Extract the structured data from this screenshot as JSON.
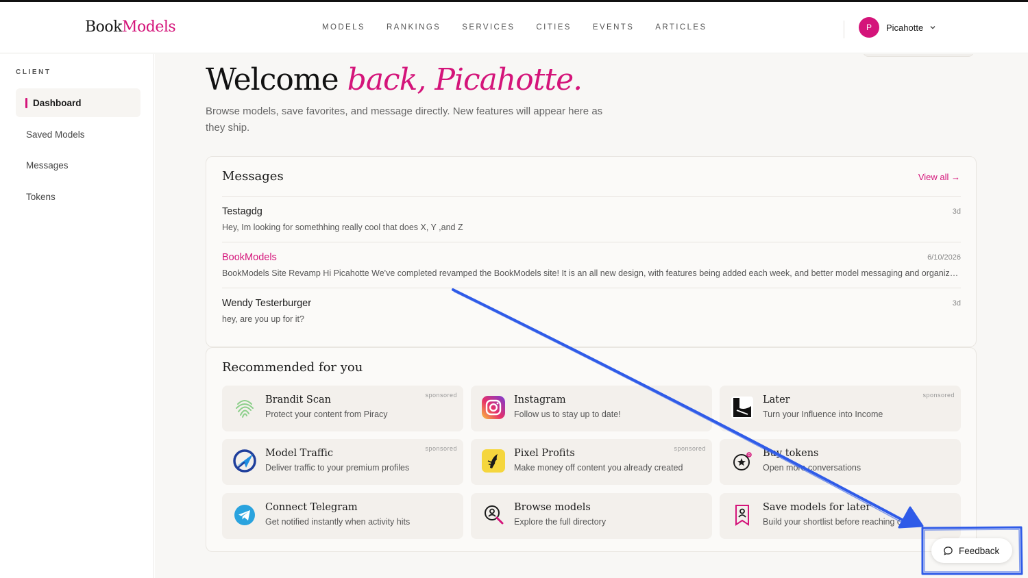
{
  "brand": {
    "part1": "Book",
    "part2": "Models"
  },
  "nav": [
    "MODELS",
    "RANKINGS",
    "SERVICES",
    "CITIES",
    "EVENTS",
    "ARTICLES"
  ],
  "user": {
    "initial": "P",
    "name": "Picahotte"
  },
  "sidebar": {
    "heading": "CLIENT",
    "items": [
      {
        "label": "Dashboard",
        "active": true
      },
      {
        "label": "Saved Models",
        "active": false
      },
      {
        "label": "Messages",
        "active": false
      },
      {
        "label": "Tokens",
        "active": false
      }
    ]
  },
  "welcome": {
    "lead": "Welcome",
    "accent": "back, Picahotte.",
    "intro": "Browse models, save favorites, and message directly. New features will appear here as they ship."
  },
  "messages": {
    "title": "Messages",
    "view_all": "View all →",
    "items": [
      {
        "from": "Testagdg",
        "time": "3d",
        "body": "Hey, Im looking for somethhing really cool that does X, Y ,and Z"
      },
      {
        "from": "BookModels",
        "time": "6/10/2026",
        "body": "BookModels Site Revamp Hi Picahotte We've completed revamped the BookModels site! It is an all new design, with features being added each week, and better model messaging and organization tools coming soon."
      },
      {
        "from": "Wendy Testerburger",
        "time": "3d",
        "body": "hey, are you up for it?"
      }
    ]
  },
  "recommended": {
    "title": "Recommended for you",
    "sponsored_label": "sponsored",
    "tiles": [
      {
        "name": "Brandit Scan",
        "desc": "Protect your content from Piracy",
        "sponsored": true,
        "icon": "fingerprint-icon"
      },
      {
        "name": "Instagram",
        "desc": "Follow us to stay up to date!",
        "sponsored": false,
        "icon": "instagram-icon"
      },
      {
        "name": "Later",
        "desc": "Turn your Influence into Income",
        "sponsored": true,
        "icon": "later-logo-icon"
      },
      {
        "name": "Model Traffic",
        "desc": "Deliver traffic to your premium profiles",
        "sponsored": true,
        "icon": "model-traffic-logo-icon"
      },
      {
        "name": "Pixel Profits",
        "desc": "Make money off content you already created",
        "sponsored": true,
        "icon": "pixel-profits-logo-icon"
      },
      {
        "name": "Buy tokens",
        "desc": "Open more conversations",
        "sponsored": false,
        "icon": "token-star-icon"
      },
      {
        "name": "Connect Telegram",
        "desc": "Get notified instantly when activity hits",
        "sponsored": false,
        "icon": "telegram-icon"
      },
      {
        "name": "Browse models",
        "desc": "Explore the full directory",
        "sponsored": false,
        "icon": "search-person-icon"
      },
      {
        "name": "Save models for later",
        "desc": "Build your shortlist before reaching out",
        "sponsored": false,
        "icon": "bookmark-person-icon"
      }
    ]
  },
  "feedback": {
    "label": "Feedback"
  },
  "colors": {
    "accent": "#d4147a",
    "annotation": "#2f5be8"
  }
}
